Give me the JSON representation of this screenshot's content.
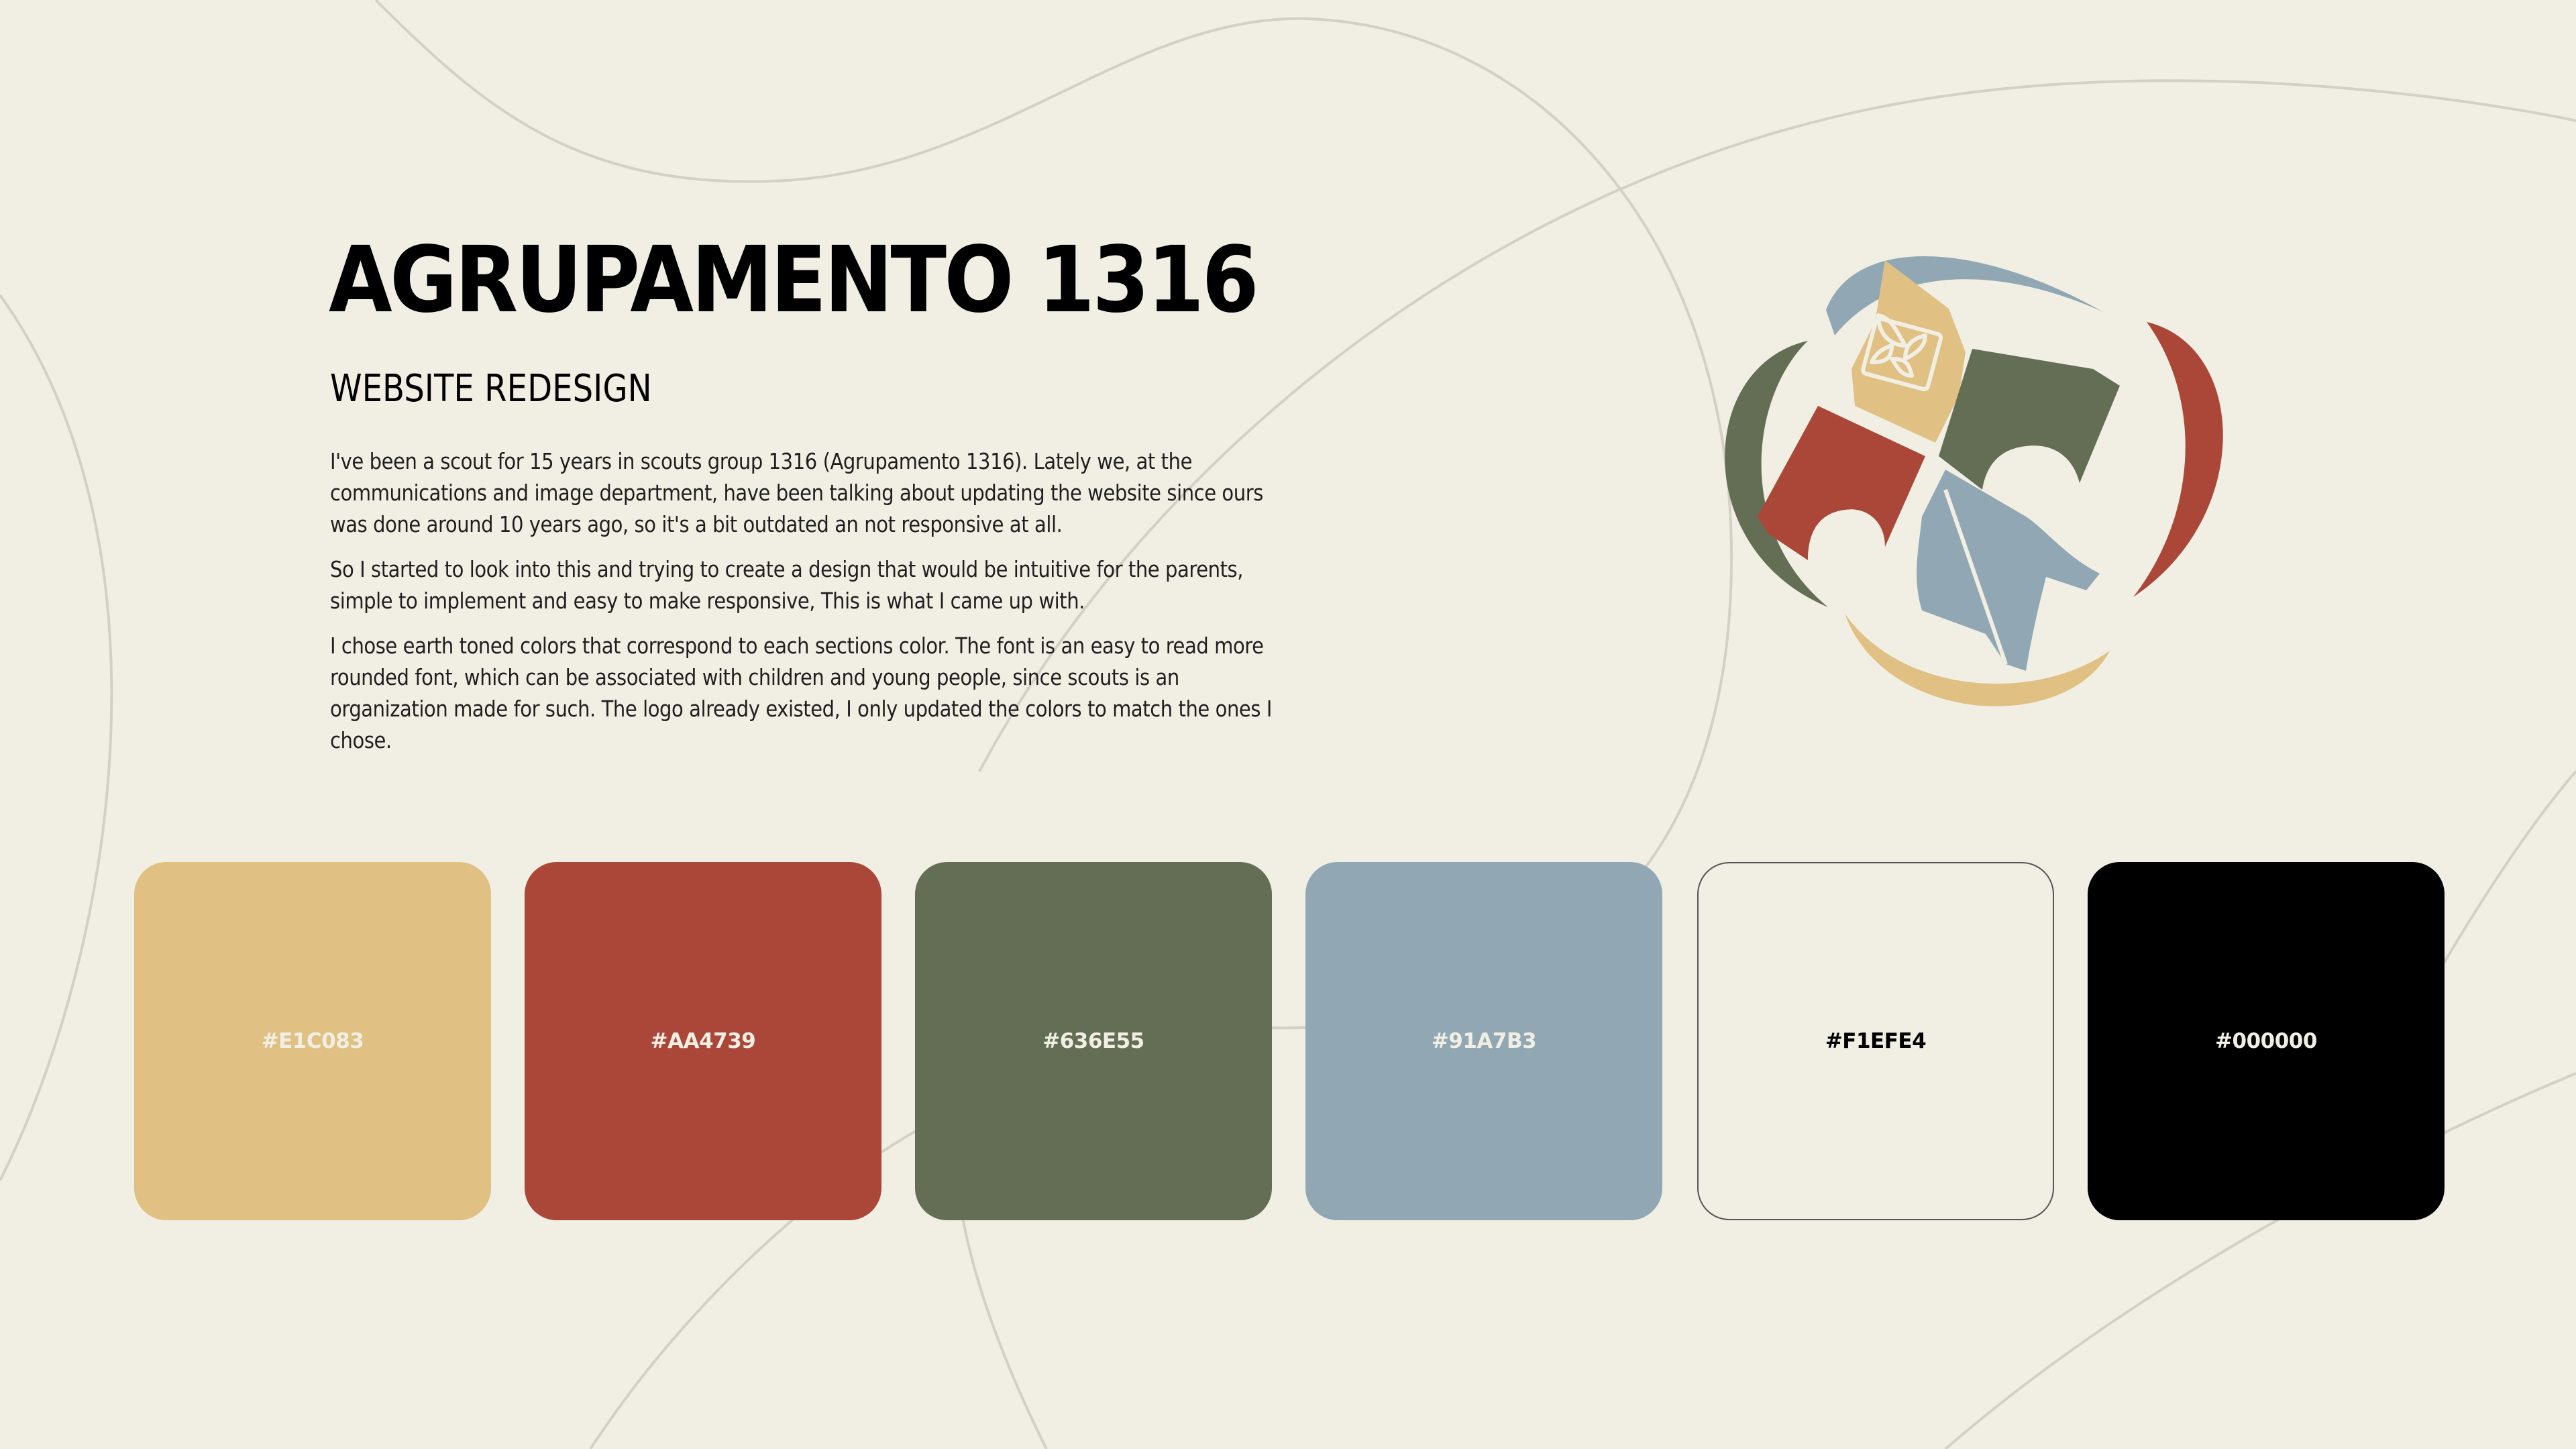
{
  "header": {
    "title": "AGRUPAMENTO 1316",
    "subtitle": "WEBSITE REDESIGN"
  },
  "description": {
    "paragraphs": [
      "I've been a scout for 15 years in scouts group 1316 (Agrupamento 1316). Lately we, at the communications and image department, have been talking about updating the website since ours was done around 10 years ago, so it's a bit outdated an not responsive at all.",
      "So I started to look into this and trying to create a design that would be intuitive for the parents, simple to implement and easy to make responsive, This is what I came up with.",
      "I chose earth toned colors that correspond to each sections color. The font is an easy to read more rounded font, which can be associated with children and young people, since scouts is an organization made for such. The logo already existed, I only updated the colors to match the ones I chose."
    ]
  },
  "palette": {
    "swatches": [
      {
        "hex": "#E1C083",
        "label": "#E1C083",
        "label_color": "#F1EFE4",
        "border": "none"
      },
      {
        "hex": "#AA4739",
        "label": "#AA4739",
        "label_color": "#F1EFE4",
        "border": "none"
      },
      {
        "hex": "#636E55",
        "label": "#636E55",
        "label_color": "#F1EFE4",
        "border": "none"
      },
      {
        "hex": "#91A7B3",
        "label": "#91A7B3",
        "label_color": "#F1EFE4",
        "border": "none"
      },
      {
        "hex": "#F1EFE4",
        "label": "#F1EFE4",
        "label_color": "#000000",
        "border": "2px solid #555555"
      },
      {
        "hex": "#000000",
        "label": "#000000",
        "label_color": "#F1EFE4",
        "border": "none"
      }
    ]
  },
  "logo": {
    "icon": "scout-fleur-de-lis-logo",
    "colors": {
      "yellow": "#E1C083",
      "red": "#AA4739",
      "green": "#636E55",
      "blue": "#91A7B3",
      "background": "#F1EFE4"
    }
  },
  "background": {
    "color": "#F1EFE4",
    "line_color": "#D3D1C5"
  }
}
